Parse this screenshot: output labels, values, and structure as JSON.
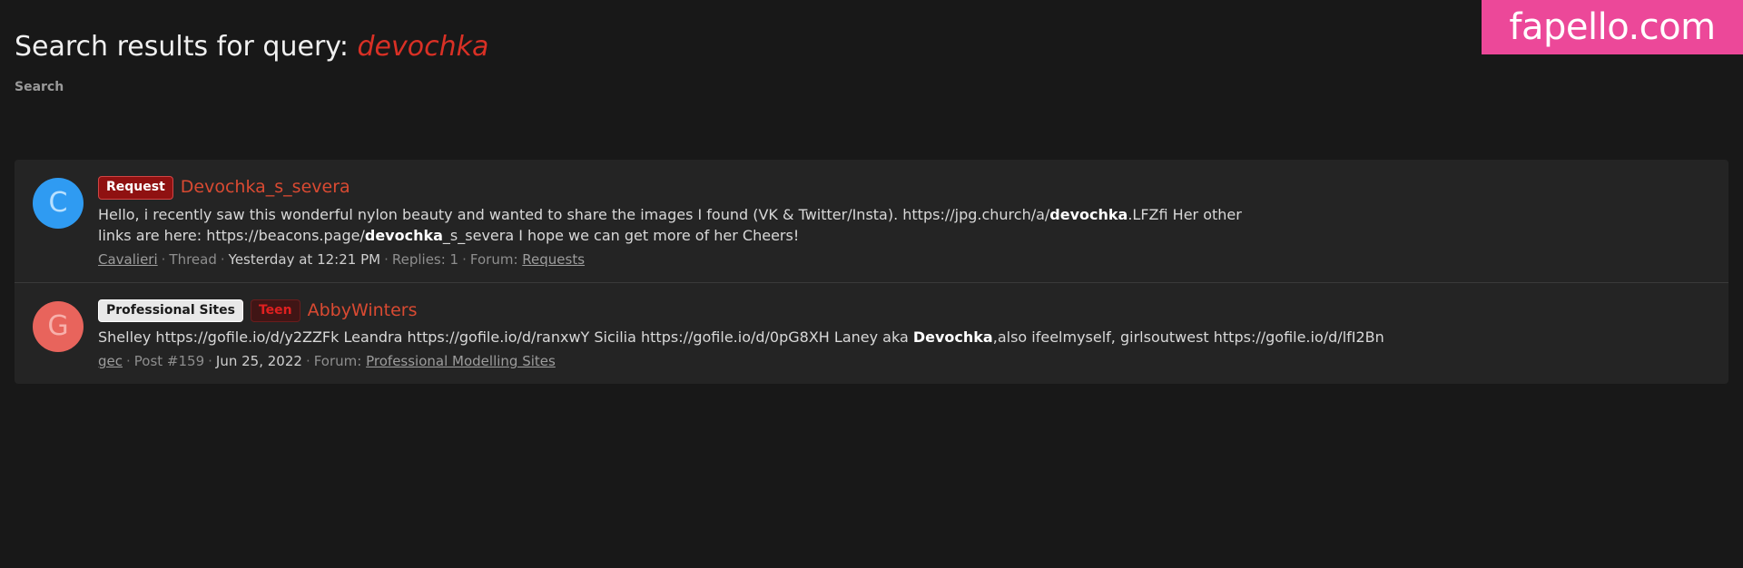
{
  "watermark": {
    "text": "fapello.com",
    "color": "#ec4899"
  },
  "page": {
    "title_prefix": "Search results for query:",
    "query": "devochka"
  },
  "breadcrumb": {
    "label": "Search"
  },
  "results": [
    {
      "avatar": {
        "letter": "C",
        "bg": "#2f9bf2",
        "fg": "#b8e0ff"
      },
      "badges": [
        {
          "label": "Request",
          "style": "request"
        }
      ],
      "title": "Devochka_s_severa",
      "snippet_parts": [
        {
          "text": "Hello, i recently saw this wonderful nylon beauty and wanted to share the images I found (VK & Twitter/Insta). https://jpg.church/a/",
          "bold": false
        },
        {
          "text": "devochka",
          "bold": true
        },
        {
          "text": ".LFZfi Her other links are here: https://beacons.page/",
          "bold": false
        },
        {
          "text": "devochka",
          "bold": true
        },
        {
          "text": "_s_severa I hope we can get more of her Cheers!",
          "bold": false
        }
      ],
      "meta": {
        "author": "Cavalieri",
        "type": "Thread",
        "date": "Yesterday at 12:21 PM",
        "replies": "Replies: 1",
        "forum_label": "Forum:",
        "forum": "Requests"
      }
    },
    {
      "avatar": {
        "letter": "G",
        "bg": "#e8645c",
        "fg": "#f7b0ab"
      },
      "badges": [
        {
          "label": "Professional Sites",
          "style": "prof"
        },
        {
          "label": "Teen",
          "style": "teen"
        }
      ],
      "title": "AbbyWinters",
      "snippet_parts": [
        {
          "text": "Shelley https://gofile.io/d/y2ZZFk Leandra https://gofile.io/d/ranxwY Sicilia https://gofile.io/d/0pG8XH Laney aka ",
          "bold": false
        },
        {
          "text": "Devochka",
          "bold": true
        },
        {
          "text": ",also ifeelmyself, girlsoutwest https://gofile.io/d/lfI2Bn",
          "bold": false
        }
      ],
      "meta": {
        "author": "gec",
        "type": "Post #159",
        "date": "Jun 25, 2022",
        "replies": "",
        "forum_label": "Forum:",
        "forum": "Professional Modelling Sites"
      }
    }
  ]
}
